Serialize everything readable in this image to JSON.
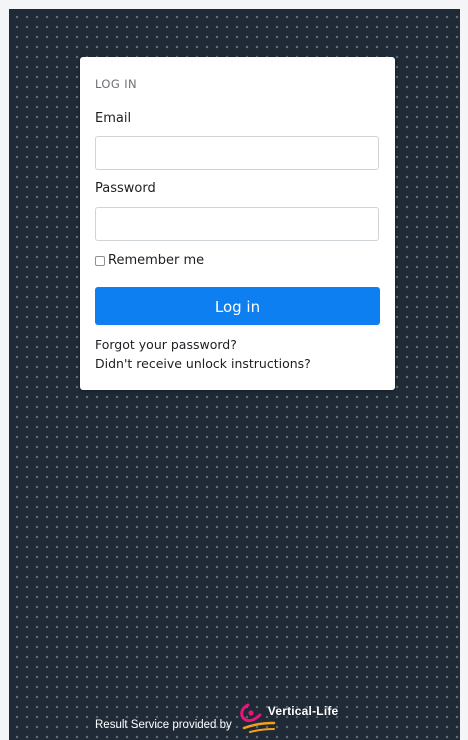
{
  "login": {
    "title": "LOG IN",
    "email_label": "Email",
    "email_value": "",
    "password_label": "Password",
    "password_value": "",
    "remember_label": "Remember me",
    "remember_checked": false,
    "submit_label": "Log in",
    "forgot_link": "Forgot your password?",
    "unlock_link": "Didn't receive unlock instructions?"
  },
  "footer": {
    "text": "Result Service provided by",
    "brand": "Vertical-Life",
    "logo_icon": "vertical-life-logo-icon"
  },
  "colors": {
    "background": "#1f2a36",
    "dots": "#96aaaa",
    "card": "#ffffff",
    "primary": "#0d7ff1",
    "logo_magenta": "#e6157a",
    "logo_orange": "#f5a01a"
  }
}
